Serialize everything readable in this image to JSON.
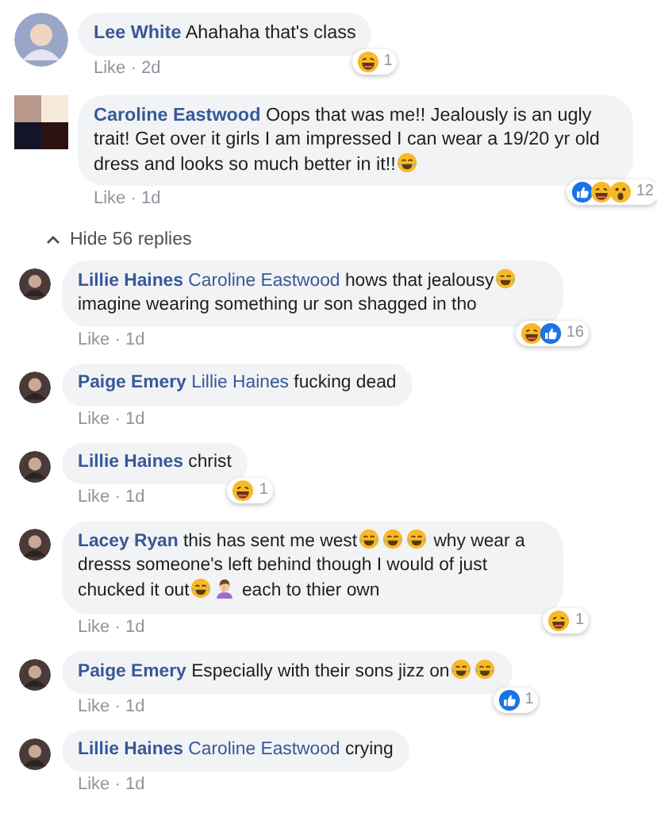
{
  "comments": [
    {
      "avatar": {
        "kind": "round"
      },
      "author": "Lee White",
      "body": [
        {
          "kind": "text",
          "text": "Ahahaha that's class"
        }
      ],
      "like": "Like",
      "dot": "·",
      "time": "2d",
      "reactions": {
        "icons": [
          {
            "kind": "laugh"
          }
        ],
        "count": "1"
      }
    },
    {
      "avatar": {
        "kind": "square"
      },
      "author": "Caroline Eastwood",
      "body": [
        {
          "kind": "text",
          "text": "Oops that was me!! Jealously is an ugly trait! Get over it girls I am impressed I can wear a 19/20 yr old dress and looks so much better in it!!"
        },
        {
          "kind": "tears_of_joy"
        }
      ],
      "like": "Like",
      "dot": "·",
      "time": "1d",
      "reactions": {
        "icons": [
          {
            "kind": "like"
          },
          {
            "kind": "laugh"
          },
          {
            "kind": "wow"
          }
        ],
        "count": "12"
      },
      "replies_toggle": {
        "label": "Hide 56 replies",
        "expanded": true
      },
      "replies": [
        {
          "avatar": {
            "kind": "round"
          },
          "author": "Lillie Haines",
          "body": [
            {
              "kind": "mention",
              "text": "Caroline Eastwood"
            },
            {
              "kind": "text",
              "text": "hows that jealousy"
            },
            {
              "kind": "tears_of_joy"
            },
            {
              "kind": "text",
              "text": "imagine wearing something ur son shagged in tho"
            }
          ],
          "like": "Like",
          "dot": "·",
          "time": "1d",
          "reactions": {
            "icons": [
              {
                "kind": "laugh"
              },
              {
                "kind": "like"
              }
            ],
            "count": "16"
          }
        },
        {
          "avatar": {
            "kind": "round"
          },
          "author": "Paige Emery",
          "body": [
            {
              "kind": "mention",
              "text": "Lillie Haines"
            },
            {
              "kind": "text",
              "text": "fucking dead"
            }
          ],
          "like": "Like",
          "dot": "·",
          "time": "1d"
        },
        {
          "avatar": {
            "kind": "round"
          },
          "author": "Lillie Haines",
          "body": [
            {
              "kind": "text",
              "text": "christ"
            }
          ],
          "like": "Like",
          "dot": "·",
          "time": "1d",
          "reactions": {
            "icons": [
              {
                "kind": "laugh"
              }
            ],
            "count": "1"
          }
        },
        {
          "avatar": {
            "kind": "round"
          },
          "author": "Lacey Ryan",
          "body": [
            {
              "kind": "text",
              "text": "this has sent me west"
            },
            {
              "kind": "tears_of_joy"
            },
            {
              "kind": "tears_of_joy"
            },
            {
              "kind": "tears_of_joy"
            },
            {
              "kind": "text",
              "text": "why wear a dresss someone's left behind though I would of just chucked it out"
            },
            {
              "kind": "tears_of_joy"
            },
            {
              "kind": "facepalm"
            },
            {
              "kind": "text",
              "text": "each to thier own"
            }
          ],
          "like": "Like",
          "dot": "·",
          "time": "1d",
          "reactions": {
            "icons": [
              {
                "kind": "laugh"
              }
            ],
            "count": "1"
          }
        },
        {
          "avatar": {
            "kind": "round"
          },
          "author": "Paige Emery",
          "body": [
            {
              "kind": "text",
              "text": "Especially with their sons jizz on"
            },
            {
              "kind": "tears_of_joy"
            },
            {
              "kind": "tears_of_joy"
            }
          ],
          "like": "Like",
          "dot": "·",
          "time": "1d",
          "reactions": {
            "icons": [
              {
                "kind": "like"
              }
            ],
            "count": "1"
          }
        },
        {
          "avatar": {
            "kind": "round"
          },
          "author": "Lillie Haines",
          "body": [
            {
              "kind": "mention",
              "text": "Caroline Eastwood"
            },
            {
              "kind": "text",
              "text": "crying"
            }
          ],
          "like": "Like",
          "dot": "·",
          "time": "1d"
        }
      ]
    }
  ]
}
